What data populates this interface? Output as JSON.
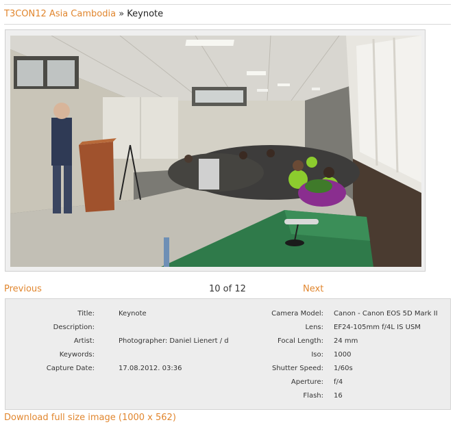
{
  "breadcrumb": {
    "parent": "T3CON12 Asia Cambodia",
    "separator": "»",
    "current": "Keynote"
  },
  "photo": {
    "alt": "Keynote"
  },
  "navigation": {
    "previous": "Previous",
    "counter": "10 of 12",
    "next": "Next"
  },
  "metadata": {
    "left": [
      {
        "label": "Title:",
        "value": "Keynote"
      },
      {
        "label": "Description:",
        "value": ""
      },
      {
        "label": "Artist:",
        "value": "Photographer: Daniel Lienert / d"
      },
      {
        "label": "Keywords:",
        "value": ""
      },
      {
        "label": "Capture Date:",
        "value": "17.08.2012. 03:36"
      }
    ],
    "right": [
      {
        "label": "Camera Model:",
        "value": "Canon - Canon EOS 5D Mark II"
      },
      {
        "label": "Lens:",
        "value": "EF24-105mm f/4L IS USM"
      },
      {
        "label": "Focal Length:",
        "value": "24 mm"
      },
      {
        "label": "Iso:",
        "value": "1000"
      },
      {
        "label": "Shutter Speed:",
        "value": "1/60s"
      },
      {
        "label": "Aperture:",
        "value": "f/4"
      },
      {
        "label": "Flash:",
        "value": "16"
      }
    ]
  },
  "download": {
    "label": "Download full size image (1000 x 562)"
  },
  "colors": {
    "link": "#e1862e",
    "panel": "#ededed"
  }
}
